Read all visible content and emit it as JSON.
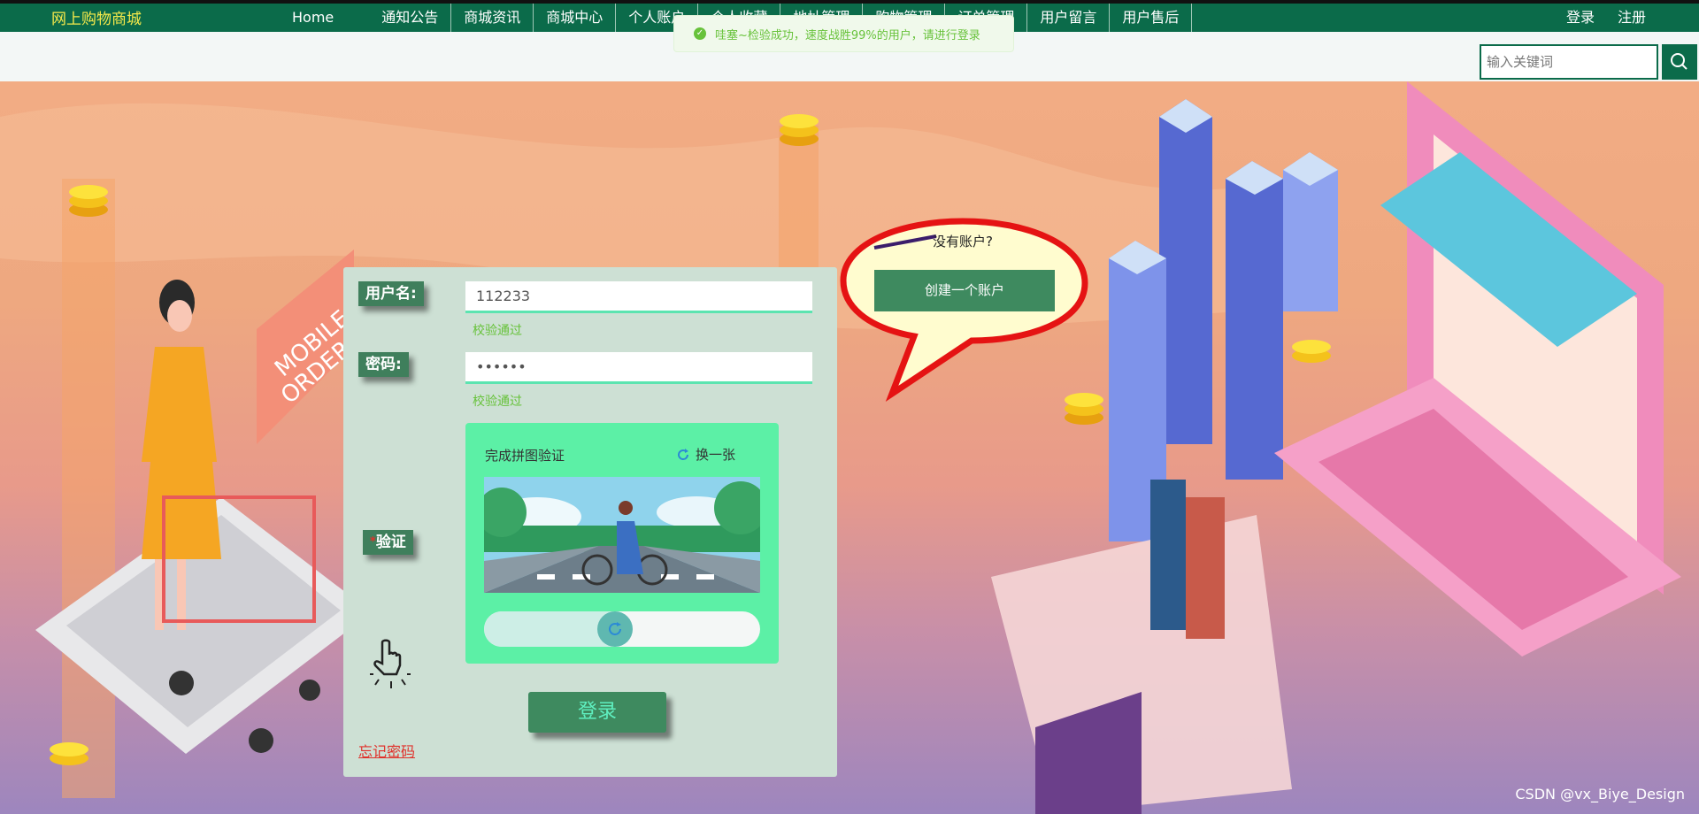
{
  "nav": {
    "brand": "网上购物商城",
    "items": [
      "Home",
      "通知公告",
      "商城资讯",
      "商城中心",
      "个人账户",
      "个人收藏",
      "地址管理",
      "购物管理",
      "订单管理",
      "用户留言",
      "用户售后"
    ],
    "auth": {
      "login": "登录",
      "register": "注册"
    },
    "accent": "#0b6b4a"
  },
  "toast": {
    "message": "哇塞~检验成功，速度战胜99%的用户，请进行登录",
    "color": "#67c23a"
  },
  "search": {
    "placeholder": "输入关键词"
  },
  "hero": {
    "sign_text": [
      "MOBILE",
      "ORDER"
    ]
  },
  "login": {
    "username_label": "用户名:",
    "username_value": "112233",
    "username_hint": "校验通过",
    "password_label": "密码:",
    "password_value": "••••••",
    "password_hint": "校验通过",
    "verify_label": "验证",
    "verify_required": "*",
    "captcha_title": "完成拼图验证",
    "captcha_refresh": "换一张",
    "slider_progress": 0.47,
    "submit": "登录",
    "forgot": "忘记密码"
  },
  "bubble": {
    "question": "没有账户?",
    "create": "创建一个账户"
  },
  "watermark": "CSDN @vx_Biye_Design"
}
